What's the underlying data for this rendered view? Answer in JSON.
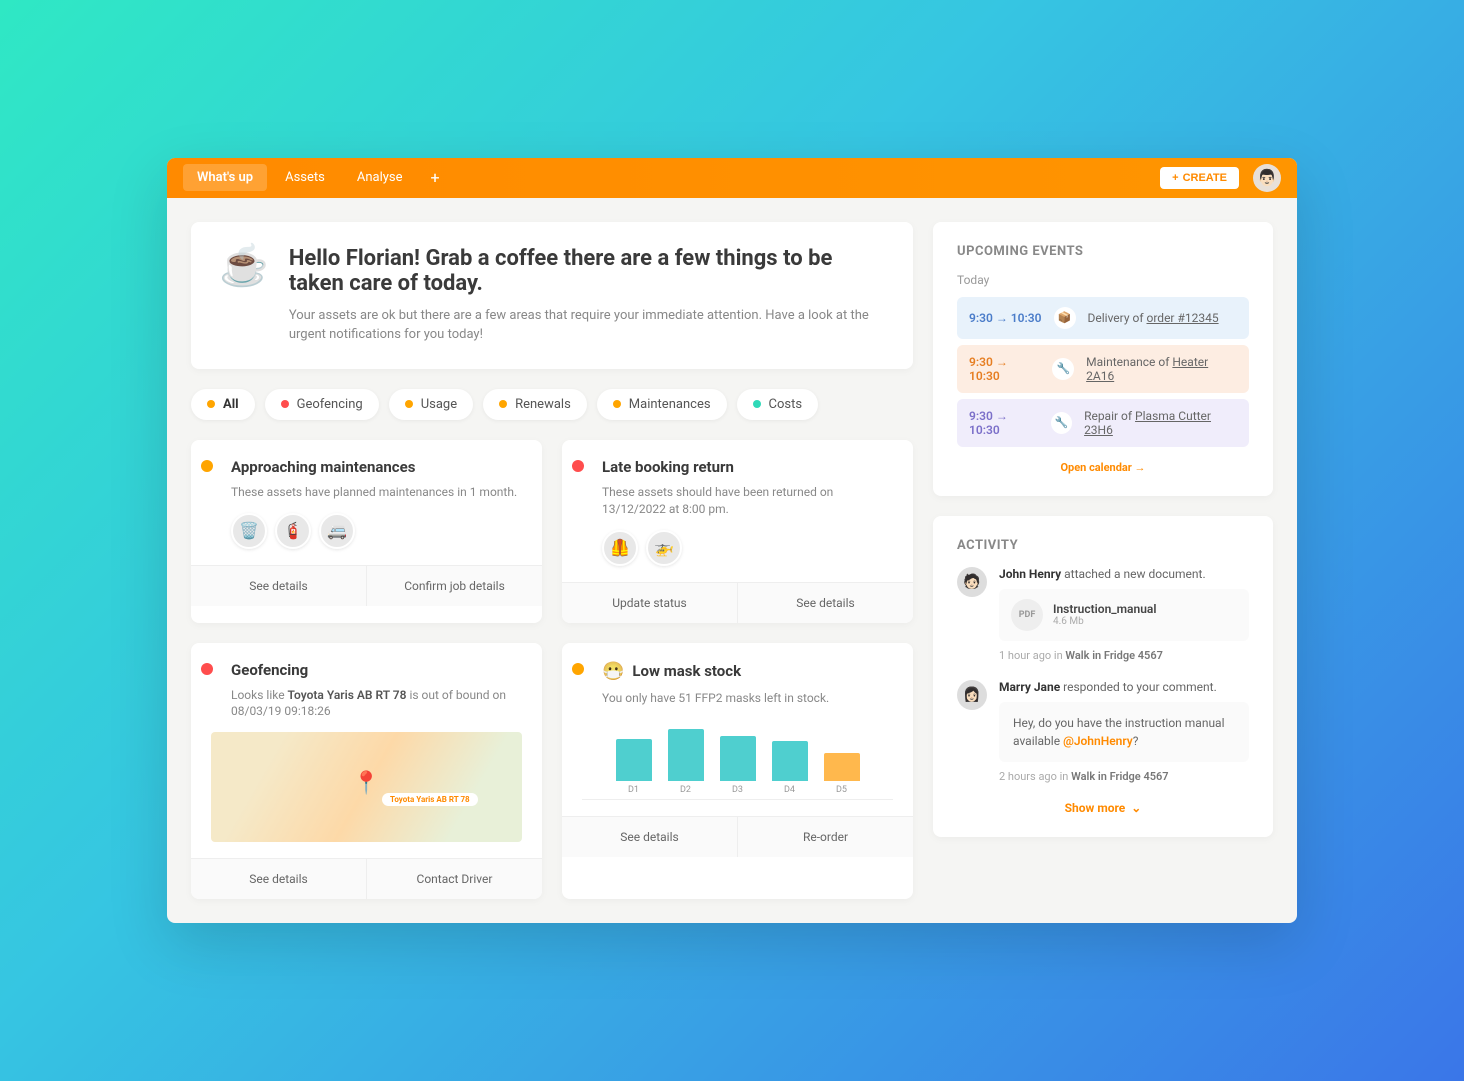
{
  "nav": {
    "tabs": [
      "What's up",
      "Assets",
      "Analyse"
    ],
    "create": "CREATE"
  },
  "hello": {
    "title": "Hello Florian! Grab a coffee there are a few things to be taken care of today.",
    "sub": "Your assets are ok but there are a few areas that require your immediate attention. Have a look at the urgent notifications for you today!"
  },
  "filters": {
    "all": "All",
    "geofencing": "Geofencing",
    "usage": "Usage",
    "renewals": "Renewals",
    "maintenances": "Maintenances",
    "costs": "Costs"
  },
  "cards": {
    "maint": {
      "title": "Approaching maintenances",
      "desc": "These assets have planned maintenances in 1 month.",
      "actions": {
        "details": "See details",
        "confirm": "Confirm job details"
      }
    },
    "late": {
      "title": "Late booking return",
      "desc": "These assets should have been returned on 13/12/2022 at 8:00 pm.",
      "actions": {
        "update": "Update status",
        "details": "See details"
      }
    },
    "geo": {
      "title": "Geofencing",
      "desc_pre": "Looks like ",
      "asset": "Toyota Yaris AB RT 78",
      "desc_post": " is out of bound on 08/03/19 09:18:26",
      "pin_label": "Toyota Yaris AB RT 78",
      "actions": {
        "details": "See details",
        "contact": "Contact Driver"
      }
    },
    "mask": {
      "title": "Low mask stock",
      "desc": "You only have 51 FFP2 masks left in stock.",
      "actions": {
        "details": "See details",
        "reorder": "Re-order"
      }
    }
  },
  "chart_data": {
    "type": "bar",
    "categories": [
      "D1",
      "D2",
      "D3",
      "D4",
      "D5"
    ],
    "values": [
      42,
      52,
      45,
      40,
      28
    ],
    "highlight_index": 4,
    "title": "Low mask stock",
    "ylim": [
      0,
      60
    ]
  },
  "events": {
    "title": "UPCOMING EVENTS",
    "today": "Today",
    "items": [
      {
        "start": "9:30",
        "end": "10:30",
        "text": "Delivery of ",
        "link": "order #12345",
        "variant": "blue",
        "icon": "📦"
      },
      {
        "start": "9:30",
        "end": "10:30",
        "text": "Maintenance of ",
        "link": "Heater 2A16",
        "variant": "orange",
        "icon": "🔧"
      },
      {
        "start": "9:30",
        "end": "10:30",
        "text": "Repair of ",
        "link": "Plasma Cutter 23H6",
        "variant": "purple",
        "icon": "🔧"
      }
    ],
    "open": "Open calendar →"
  },
  "activity": {
    "title": "ACTIVITY",
    "items": [
      {
        "user": "John Henry",
        "action": " attached a new document.",
        "attachment": {
          "name": "Instruction_manual",
          "size": "4.6 Mb",
          "type": "PDF"
        },
        "meta_pre": "1 hour ago in ",
        "meta_ref": "Walk in Fridge 4567"
      },
      {
        "user": "Marry Jane",
        "action": " responded to your comment.",
        "comment": {
          "text_pre": "Hey, do you have the instruction manual available ",
          "mention": "@JohnHenry",
          "text_post": "?"
        },
        "meta_pre": "2 hours ago in ",
        "meta_ref": "Walk in Fridge 4567"
      }
    ],
    "show_more": "Show more"
  }
}
